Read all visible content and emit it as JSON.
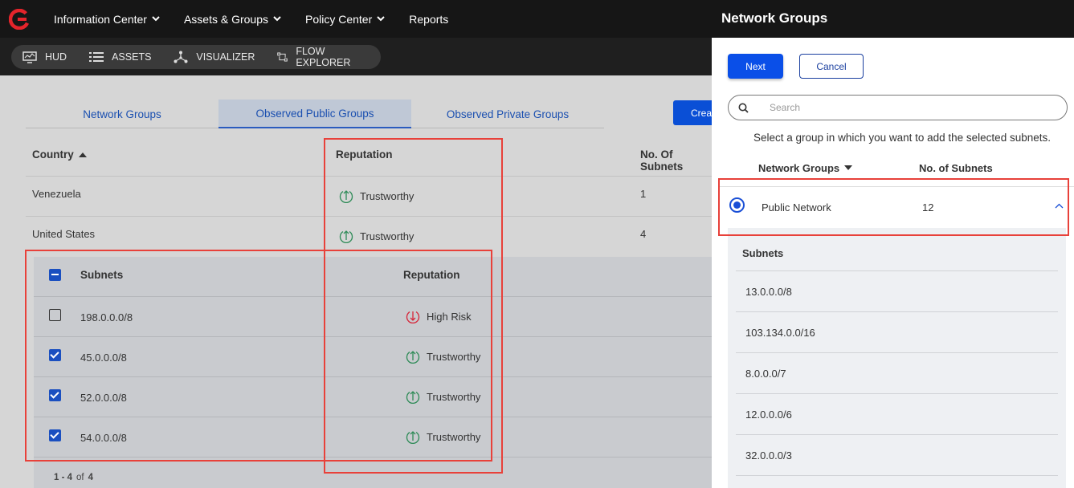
{
  "topnav": {
    "items": [
      {
        "label": "Information Center",
        "has_dropdown": true
      },
      {
        "label": "Assets & Groups",
        "has_dropdown": true
      },
      {
        "label": "Policy Center",
        "has_dropdown": true
      },
      {
        "label": "Reports",
        "has_dropdown": false
      }
    ]
  },
  "subnav": {
    "items": [
      {
        "label": "HUD",
        "icon": "monitor-icon"
      },
      {
        "label": "ASSETS",
        "icon": "list-icon"
      },
      {
        "label": "VISUALIZER",
        "icon": "network-icon"
      },
      {
        "label": "FLOW EXPLORER",
        "icon": "flow-icon"
      }
    ]
  },
  "main": {
    "tabs": [
      "Network Groups",
      "Observed Public Groups",
      "Observed Private Groups"
    ],
    "active_tab": "Observed Public Groups",
    "create_button": "Creat",
    "table": {
      "headers": {
        "country": "Country",
        "reputation": "Reputation",
        "subnets": "No. Of Subnets"
      },
      "rows": [
        {
          "country": "Venezuela",
          "reputation": "Trustworthy",
          "subnets": "1"
        },
        {
          "country": "United States",
          "reputation": "Trustworthy",
          "subnets": "4"
        }
      ]
    },
    "subtable": {
      "headers": {
        "subnets": "Subnets",
        "reputation": "Reputation"
      },
      "rows": [
        {
          "subnet": "198.0.0.0/8",
          "reputation": "High Risk",
          "checked": false
        },
        {
          "subnet": "45.0.0.0/8",
          "reputation": "Trustworthy",
          "checked": true
        },
        {
          "subnet": "52.0.0.0/8",
          "reputation": "Trustworthy",
          "checked": true
        },
        {
          "subnet": "54.0.0.0/8",
          "reputation": "Trustworthy",
          "checked": true
        }
      ],
      "pagination": {
        "range": "1 - 4",
        "of": "of",
        "total": "4"
      }
    }
  },
  "drawer": {
    "title": "Network Groups",
    "next_button": "Next",
    "cancel_button": "Cancel",
    "search_placeholder": "Search",
    "hint": "Select a group in which you want to add the selected subnets.",
    "headers": {
      "group": "Network Groups",
      "subnets": "No. of Subnets"
    },
    "group": {
      "name": "Public Network",
      "count": "12"
    },
    "subnets_header": "Subnets",
    "subnets": [
      "13.0.0.0/8",
      "103.134.0.0/16",
      "8.0.0.0/7",
      "12.0.0.0/6",
      "32.0.0.0/3"
    ]
  },
  "colors": {
    "accent": "#0a4fe8",
    "trustworthy": "#2e8b57",
    "high_risk": "#d6263a",
    "highlight": "#e8413a"
  }
}
